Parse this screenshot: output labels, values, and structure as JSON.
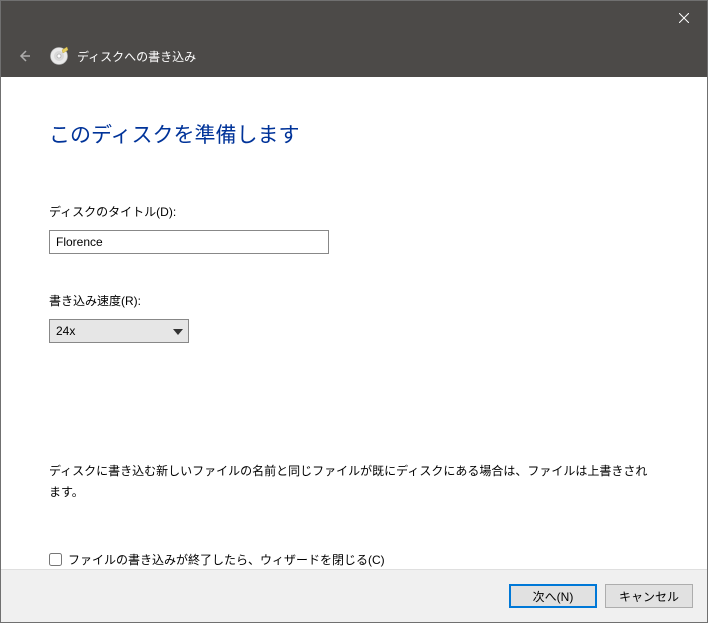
{
  "titlebar": {
    "close_label": "Close"
  },
  "header": {
    "title": "ディスクへの書き込み"
  },
  "content": {
    "heading": "このディスクを準備します",
    "title_label": "ディスクのタイトル(D):",
    "title_value": "Florence",
    "speed_label": "書き込み速度(R):",
    "speed_value": "24x",
    "note": "ディスクに書き込む新しいファイルの名前と同じファイルが既にディスクにある場合は、ファイルは上書きされます。",
    "close_wizard_label": "ファイルの書き込みが終了したら、ウィザードを閉じる(C)"
  },
  "footer": {
    "next_label": "次へ(N)",
    "cancel_label": "キャンセル"
  }
}
